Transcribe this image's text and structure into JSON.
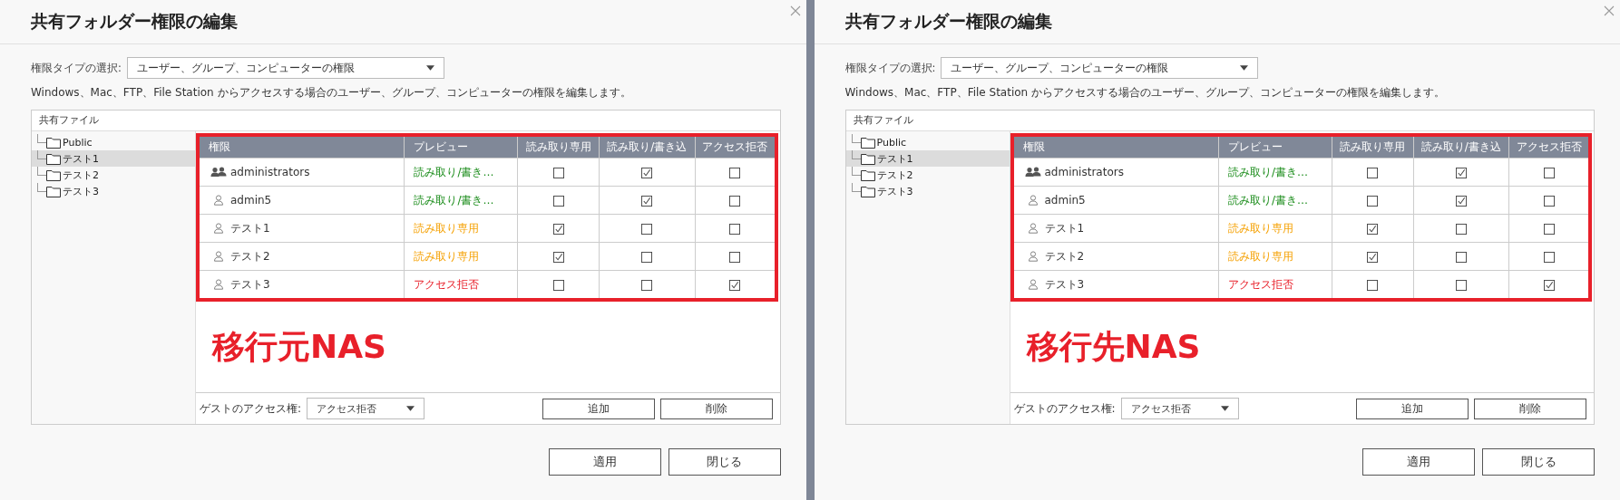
{
  "panels": [
    {
      "title": "共有フォルダー権限の編集",
      "type_label": "権限タイプの選択:",
      "type_value": "ユーザー、グループ、コンピューターの権限",
      "description": "Windows、Mac、FTP、File Station からアクセスする場合のユーザー、グループ、コンピューターの権限を編集します。",
      "tree_header": "共有ファイル",
      "folders": [
        {
          "name": "Public",
          "selected": false
        },
        {
          "name": "テスト1",
          "selected": true
        },
        {
          "name": "テスト2",
          "selected": false
        },
        {
          "name": "テスト3",
          "selected": false
        }
      ],
      "columns": [
        "権限",
        "プレビュー",
        "読み取り専用",
        "読み取り/書き込",
        "アクセス拒否"
      ],
      "rows": [
        {
          "kind": "group",
          "name": "administrators",
          "preview": {
            "text": "読み取り/書き…",
            "kind": "read_write"
          },
          "read_only": false,
          "read_write": true,
          "deny": false
        },
        {
          "kind": "user",
          "name": "admin5",
          "preview": {
            "text": "読み取り/書き…",
            "kind": "read_write"
          },
          "read_only": false,
          "read_write": true,
          "deny": false
        },
        {
          "kind": "user",
          "name": "テスト1",
          "preview": {
            "text": "読み取り専用",
            "kind": "read_only"
          },
          "read_only": true,
          "read_write": false,
          "deny": false
        },
        {
          "kind": "user",
          "name": "テスト2",
          "preview": {
            "text": "読み取り専用",
            "kind": "read_only"
          },
          "read_only": true,
          "read_write": false,
          "deny": false
        },
        {
          "kind": "user",
          "name": "テスト3",
          "preview": {
            "text": "アクセス拒否",
            "kind": "deny"
          },
          "read_only": false,
          "read_write": false,
          "deny": true
        }
      ],
      "label": "移行元NAS",
      "guest_label": "ゲストのアクセス権:",
      "guest_value": "アクセス拒否",
      "add": "追加",
      "delete": "削除",
      "apply": "適用",
      "close": "閉じる"
    },
    {
      "title": "共有フォルダー権限の編集",
      "type_label": "権限タイプの選択:",
      "type_value": "ユーザー、グループ、コンピューターの権限",
      "description": "Windows、Mac、FTP、File Station からアクセスする場合のユーザー、グループ、コンピューターの権限を編集します。",
      "tree_header": "共有ファイル",
      "folders": [
        {
          "name": "Public",
          "selected": false
        },
        {
          "name": "テスト1",
          "selected": true
        },
        {
          "name": "テスト2",
          "selected": false
        },
        {
          "name": "テスト3",
          "selected": false
        }
      ],
      "columns": [
        "権限",
        "プレビュー",
        "読み取り専用",
        "読み取り/書き込",
        "アクセス拒否"
      ],
      "rows": [
        {
          "kind": "group",
          "name": "administrators",
          "preview": {
            "text": "読み取り/書き…",
            "kind": "read_write"
          },
          "read_only": false,
          "read_write": true,
          "deny": false
        },
        {
          "kind": "user",
          "name": "admin5",
          "preview": {
            "text": "読み取り/書き…",
            "kind": "read_write"
          },
          "read_only": false,
          "read_write": true,
          "deny": false
        },
        {
          "kind": "user",
          "name": "テスト1",
          "preview": {
            "text": "読み取り専用",
            "kind": "read_only"
          },
          "read_only": true,
          "read_write": false,
          "deny": false
        },
        {
          "kind": "user",
          "name": "テスト2",
          "preview": {
            "text": "読み取り専用",
            "kind": "read_only"
          },
          "read_only": true,
          "read_write": false,
          "deny": false
        },
        {
          "kind": "user",
          "name": "テスト3",
          "preview": {
            "text": "アクセス拒否",
            "kind": "deny"
          },
          "read_only": false,
          "read_write": false,
          "deny": true
        }
      ],
      "label": "移行先NAS",
      "guest_label": "ゲストのアクセス権:",
      "guest_value": "アクセス拒否",
      "add": "追加",
      "delete": "削除",
      "apply": "適用",
      "close": "閉じる"
    }
  ]
}
